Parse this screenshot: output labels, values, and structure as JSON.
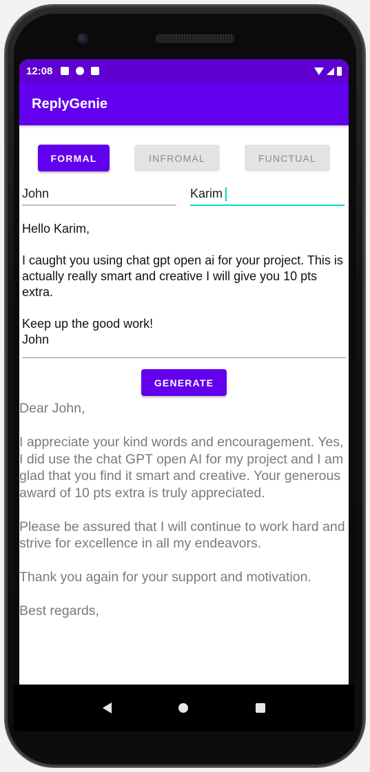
{
  "status_bar": {
    "time": "12:08"
  },
  "app_bar": {
    "title": "ReplyGenie"
  },
  "tabs": [
    {
      "label": "FORMAL",
      "active": true
    },
    {
      "label": "INFROMAL",
      "active": false
    },
    {
      "label": "FUNCTUAL",
      "active": false
    }
  ],
  "sender_field": {
    "value": "John"
  },
  "recipient_field": {
    "value": "Karim"
  },
  "message": {
    "text": "Hello Karim,\n\nI caught you using chat gpt open ai for your project. This is actually really smart and creative I will give you 10 pts extra.\n\nKeep up the good work!\nJohn"
  },
  "generate_button": {
    "label": "GENERATE"
  },
  "reply": {
    "text": "Dear John,\n\nI appreciate your kind words and encouragement. Yes, I did use the chat GPT open AI for my project and I am glad that you find it smart and creative. Your generous award of 10 pts extra is truly appreciated.\n\nPlease be assured that I will continue to work hard and strive for excellence in all my endeavors.\n\nThank you again for your support and motivation.\n\nBest regards,"
  },
  "colors": {
    "primary": "#6200ee",
    "status_bar": "#5f00d0",
    "accent": "#03dac5"
  }
}
